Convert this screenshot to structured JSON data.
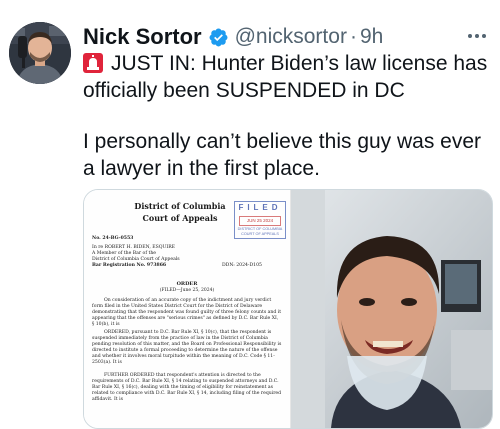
{
  "author": {
    "name": "Nick Sortor",
    "handle": "@nicksortor",
    "separator": "·",
    "time": "9h",
    "verified_icon": "verified-badge-icon",
    "verified_color": "#1d9bf0"
  },
  "tweet": {
    "line1_emoji": "siren-icon",
    "line1": "JUST IN: Hunter Biden’s law license has officially been SUSPENDED in DC",
    "line2": "I personally can’t believe this guy was ever a lawyer in the first place."
  },
  "document": {
    "court_line1": "District of Columbia",
    "court_line2": "Court of Appeals",
    "stamp_filed": "FILED",
    "stamp_date": "JUN 25 2024",
    "stamp_court": "DISTRICT OF COLUMBIA COURT OF APPEALS",
    "case_no": "No. 24-BG-0553",
    "in_re": "In re ROBERT H. BIDEN, ESQUIRE",
    "member_line1": "A Member of the Bar of the",
    "member_line2": "District of Columbia Court of Appeals",
    "bar_reg": "Bar Registration No. 973866",
    "ddn": "DDN: 2024-D105",
    "order_title": "ORDER",
    "order_filed": "(FILED—June 25, 2024)",
    "para1": "On consideration of an accurate copy of the indictment and jury verdict form filed in the United States District Court for the District of Delaware demonstrating that the respondent was found guilty of three felony counts and it appearing that the offenses are \"serious crimes\" as defined by D.C. Bar Rule XI, § 10(b), it is",
    "para2": "ORDERED, pursuant to D.C. Bar Rule XI, § 10(c), that the respondent is suspended immediately from the practice of law in the District of Columbia pending resolution of this matter, and the Board on Professional Responsibility is directed to institute a formal proceeding to determine the nature of the offense and whether it involves moral turpitude within the meaning of D.C. Code § 11-2503(a). It is",
    "para3": "FURTHER ORDERED that respondent's attention is directed to the requirements of D.C. Bar Rule XI, § 14 relating to suspended attorneys and D.C. Bar Rule XI, § 16(c), dealing with the timing of eligibility for reinstatement as related to compliance with D.C. Bar Rule XI, § 14, including filing of the required affidavit. It is"
  },
  "colors": {
    "text_primary": "#0f1419",
    "text_secondary": "#536471",
    "border": "#cfd9de",
    "siren_red": "#e0243b"
  }
}
